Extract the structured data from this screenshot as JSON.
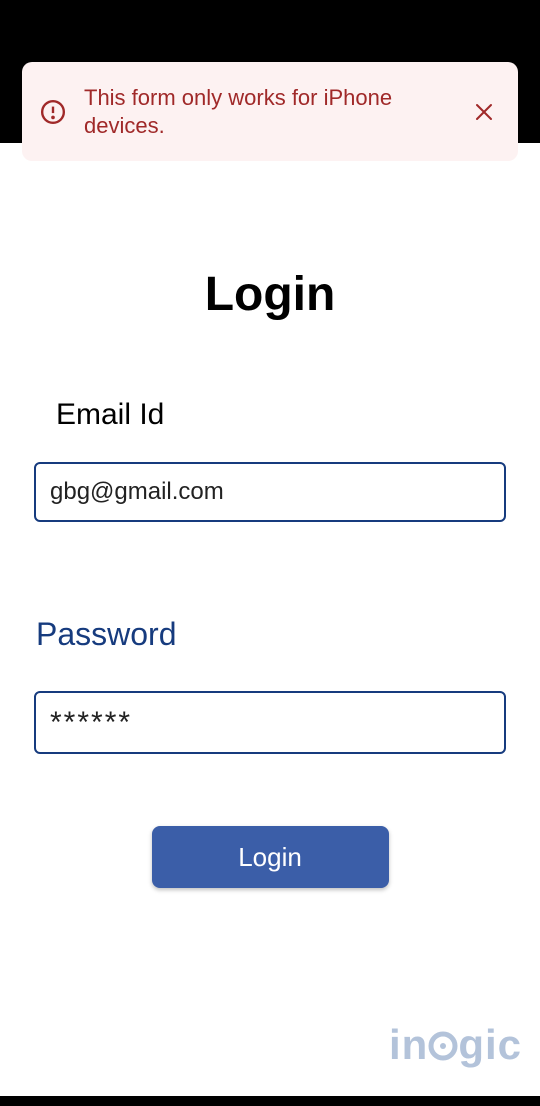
{
  "alert": {
    "message": "This form only works for iPhone devices."
  },
  "page": {
    "title": "Login"
  },
  "form": {
    "email_label": "Email Id",
    "email_value": "gbg@gmail.com",
    "password_label": "Password",
    "password_value": "******",
    "submit_label": "Login"
  },
  "brand": {
    "name": "inogic"
  }
}
